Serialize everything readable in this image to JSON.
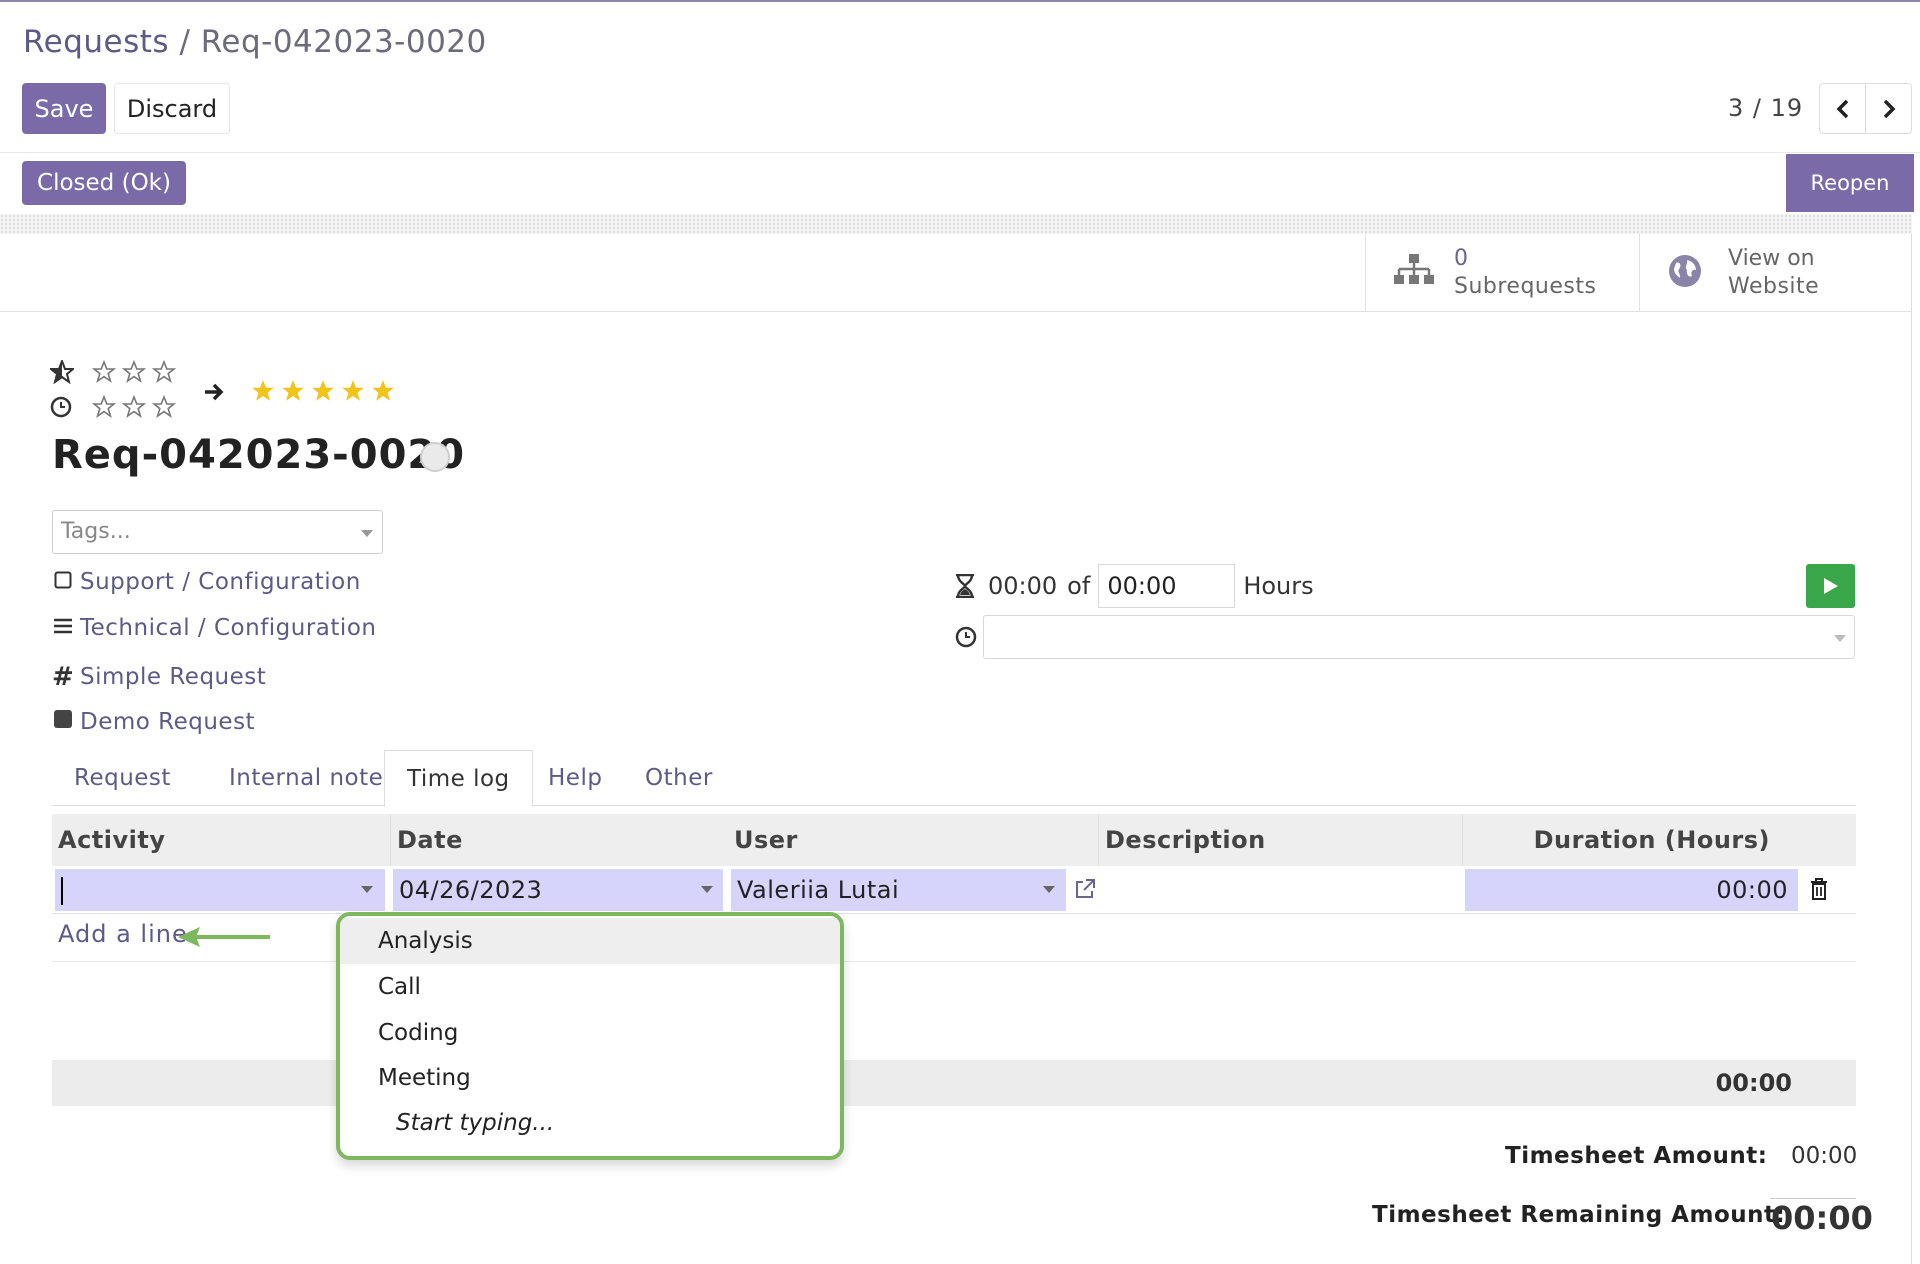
{
  "breadcrumb": {
    "parent": "Requests",
    "separator": "/",
    "current": "Req-042023-0020"
  },
  "toolbar": {
    "save_label": "Save",
    "discard_label": "Discard"
  },
  "pager": {
    "text": "3 / 19"
  },
  "status": {
    "stage": "Closed (Ok)",
    "reopen_label": "Reopen"
  },
  "smart_buttons": {
    "subrequests": {
      "count": "0",
      "label": "Subrequests"
    },
    "website": {
      "line1": "View on",
      "line2": "Website"
    }
  },
  "priority": {
    "from_stars": 1,
    "to_stars": 5,
    "max_stars": 5
  },
  "record": {
    "title": "Req-042023-0020",
    "tags_placeholder": "Tags...",
    "service": "Support / Configuration",
    "category": "Technical / Configuration",
    "type": "Simple Request",
    "kind": "Demo Request"
  },
  "timer": {
    "spent": "00:00",
    "of_label": "of",
    "planned": "00:00",
    "unit": "Hours"
  },
  "tabs": [
    {
      "label": "Request"
    },
    {
      "label": "Internal notes"
    },
    {
      "label": "Time log",
      "active": true
    },
    {
      "label": "Help"
    },
    {
      "label": "Other"
    }
  ],
  "timelog": {
    "columns": [
      "Activity",
      "Date",
      "User",
      "Description",
      "Duration (Hours)"
    ],
    "row": {
      "activity": "",
      "date": "04/26/2023",
      "user": "Valeriia Lutai",
      "description": "",
      "duration": "00:00"
    },
    "add_line": "Add a line",
    "total": "00:00"
  },
  "summary": {
    "amount_label": "Timesheet Amount:",
    "amount_value": "00:00",
    "remaining_label": "Timesheet Remaining Amount:",
    "remaining_value": "00:00"
  },
  "activity_dropdown": {
    "options": [
      "Analysis",
      "Call",
      "Coding",
      "Meeting"
    ],
    "hint": "Start typing...",
    "highlighted": "Analysis"
  },
  "colors": {
    "brand": "#7a6ba8",
    "link": "#5e5a86",
    "edit_cell": "#d6d4fb",
    "play": "#3aa64a",
    "callout": "#7eb85e",
    "star": "#f0c419"
  }
}
